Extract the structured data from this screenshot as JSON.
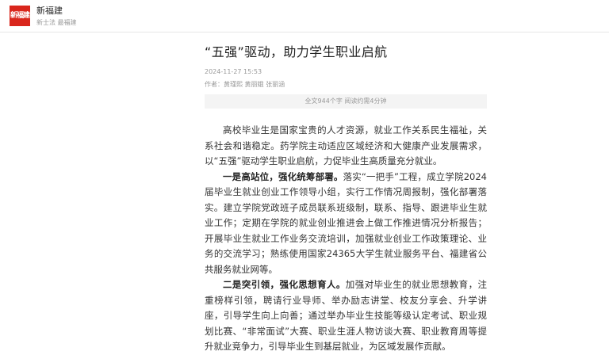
{
  "header": {
    "logo_text": "新福建",
    "site_name": "新福建",
    "site_sub": "新士法 最福建"
  },
  "article": {
    "title": "“五强”驱动，助力学生职业启航",
    "date": "2024-11-27 15:53",
    "author": "作者：黄瑾熙 黄丽娥 张丽涵",
    "stats": "全文944个字 阅读约需4分钟",
    "p1": "高校毕业生是国家宝贵的人才资源，就业工作关系民生福祉，关系社会和谐稳定。药学院主动适应区域经济和大健康产业发展需求，以“五强”驱动学生职业启航，力促毕业生高质量充分就业。",
    "p2_bold": "一是高站位，强化统筹部署。",
    "p2_text": "落实“一把手”工程，成立学院2024届毕业生就业创业工作领导小组，实行工作情况周报制，强化部署落实。建立学院党政班子成员联系班级制，联系、指导、跟进毕业生就业工作；定期在学院的就业创业推进会上做工作推进情况分析报告；开展毕业生就业工作业务交流培训，加强就业创业工作政策理论、业务的交流学习；熟练使用国家24365大学生就业服务平台、福建省公共服务就业网等。",
    "p3_bold": "二是突引领，强化思想育人。",
    "p3_text": "加强对毕业生的就业思想教育，注重榜样引领，聘请行业导师、举办励志讲堂、校友分享会、升学讲座，引导学生向上向善；通过举办毕业生技能等级认定考试、职业规划比赛、“非常面试”大赛、职业生涯人物访谈大赛、职业教育周等提升就业竞争力，引导毕业生到基层就业，为区域发展作贡献。"
  }
}
